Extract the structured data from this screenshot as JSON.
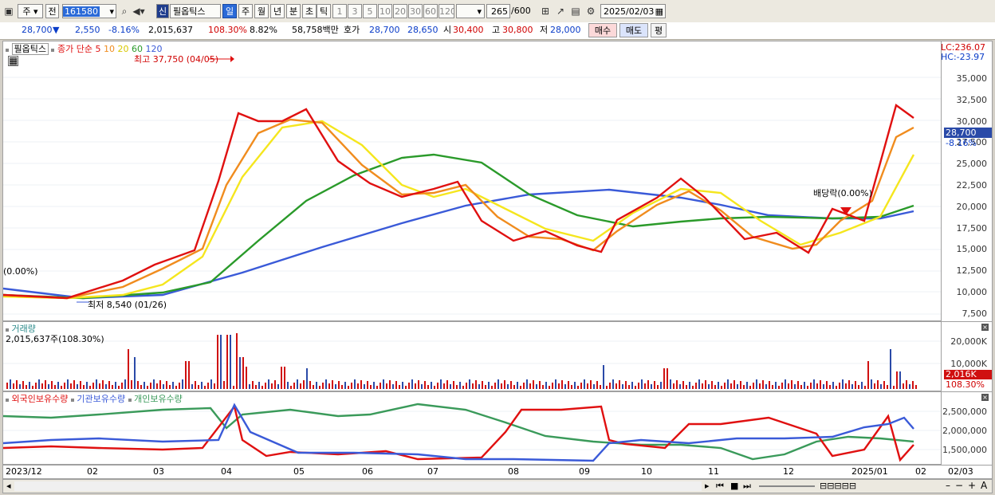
{
  "toolbar": {
    "type1": "주",
    "type2": "전",
    "code": "161580",
    "badge": "신",
    "name": "필옵틱스",
    "periods": [
      "일",
      "주",
      "월",
      "년",
      "분",
      "초",
      "틱"
    ],
    "active_period": "일",
    "intervals": [
      "1",
      "3",
      "5",
      "10",
      "20",
      "30",
      "60",
      "120"
    ],
    "count": "265",
    "count_total": "/600",
    "date": "2025/02/03"
  },
  "quote": {
    "price": "28,700",
    "arrow": "▼",
    "change": "2,550",
    "change_pct": "-8.16%",
    "volume": "2,015,637",
    "volume_ratio": "108.30%",
    "turnover": "8.82%",
    "amount": "58,758백만",
    "ask_label": "호가",
    "ask": "28,700",
    "bid": "28,650",
    "open_label": "시",
    "open": "30,400",
    "high_label": "고",
    "high": "30,800",
    "low_label": "저",
    "low": "28,000",
    "buy": "매수",
    "sell": "매도",
    "flat": "평"
  },
  "price_panel": {
    "legend_name": "필옵틱스",
    "legend_ma": "종가 단순 5",
    "ma_periods": [
      "10",
      "20",
      "60",
      "120"
    ],
    "high_note": "최고 37,750 (04/05)",
    "low_note": "최저 8,540 (01/26)",
    "start_pct": "(0.00%)",
    "dividend": "배당락(0.00%)",
    "lc": "LC:236.07",
    "hc": "HC:-23.97",
    "cur_price": "28,700",
    "cur_pct": "-8.16%",
    "y_labels": [
      "35,000",
      "32,500",
      "30,000",
      "27,500",
      "25,000",
      "22,500",
      "20,000",
      "17,500",
      "15,000",
      "12,500",
      "10,000",
      "7,500"
    ]
  },
  "volume_panel": {
    "title": "거래량",
    "value": "2,015,637주(108.30%)",
    "y_labels": [
      "20,000K",
      "10,000K"
    ],
    "cur": "2,016K",
    "cur_pct": "108.30%"
  },
  "holdings_panel": {
    "legend": [
      "외국인보유수량",
      "기관보유수량",
      "개인보유수량"
    ],
    "y_labels": [
      "2,500,000",
      "2,000,000",
      "1,500,000"
    ]
  },
  "x_axis": [
    "2023/12",
    "02",
    "03",
    "04",
    "05",
    "06",
    "07",
    "08",
    "09",
    "10",
    "11",
    "12",
    "2025/01",
    "02",
    "02/03"
  ],
  "colors": {
    "ma5": "#e01010",
    "ma10": "#f08c1e",
    "ma20": "#f5e61e",
    "ma60": "#2a9a2a",
    "ma120": "#3a5ad8",
    "foreign": "#e01010",
    "institution": "#3a5ad8",
    "individual": "#3a9a5a"
  }
}
